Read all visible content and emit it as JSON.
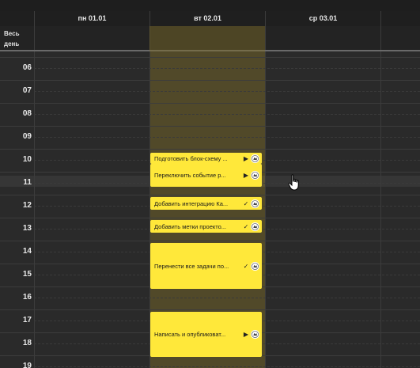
{
  "header": {
    "days": [
      {
        "label": "пн 01.01"
      },
      {
        "label": "вт 02.01"
      },
      {
        "label": "ср 03.01"
      }
    ]
  },
  "allday": {
    "label": "Весь день"
  },
  "hours": [
    "06",
    "07",
    "08",
    "09",
    "10",
    "11",
    "12",
    "13",
    "14",
    "15",
    "16",
    "17",
    "18",
    "19"
  ],
  "events": [
    {
      "title": "Подготовить блок-схему ...",
      "status": "▶",
      "status_icon": "play-icon"
    },
    {
      "title": "Переключить событие р...",
      "status": "▶",
      "status_icon": "play-icon"
    },
    {
      "title": "Добавить интеграцию Ка...",
      "status": "✓",
      "status_icon": "check-icon"
    },
    {
      "title": "Добавить метки проекто...",
      "status": "✓",
      "status_icon": "check-icon"
    },
    {
      "title": "Перенести все задачи по...",
      "status": "✓",
      "status_icon": "check-icon"
    },
    {
      "title": "Написать и опубликоват...",
      "status": "▶",
      "status_icon": "play-icon"
    }
  ],
  "colors": {
    "event": "#ffe83a",
    "today_column": "#5a5028",
    "background": "#2a2a2a"
  }
}
